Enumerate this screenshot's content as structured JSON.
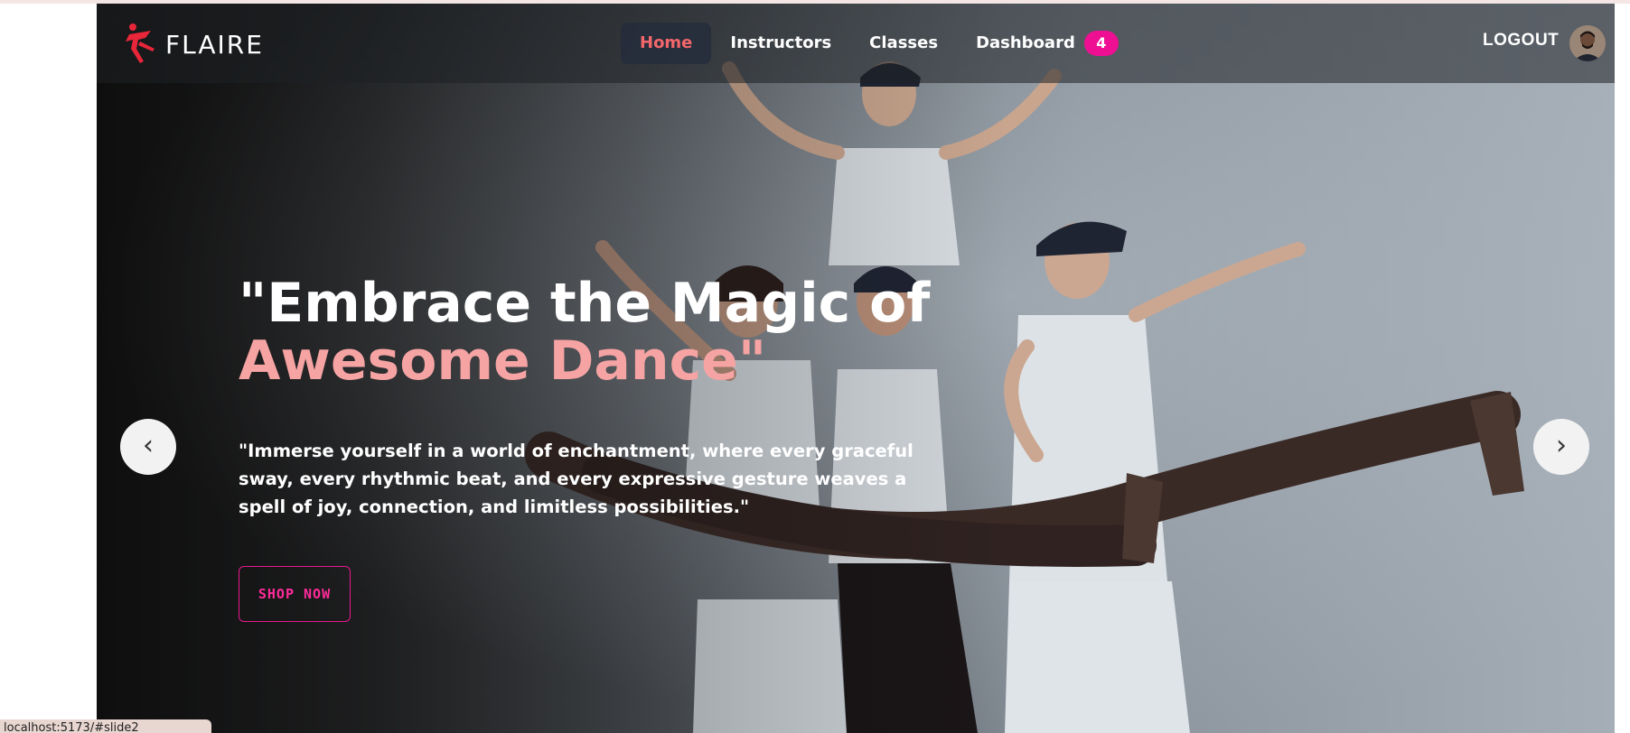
{
  "brand": {
    "name": "FLAIRE",
    "accent": "#e8263a"
  },
  "nav": {
    "items": [
      {
        "label": "Home",
        "active": true
      },
      {
        "label": "Instructors",
        "active": false
      },
      {
        "label": "Classes",
        "active": false
      },
      {
        "label": "Dashboard",
        "active": false,
        "badge": "4"
      }
    ],
    "logout_label": "LOGOUT",
    "active_color": "#f3676b",
    "badge_color": "#ef0f92"
  },
  "hero": {
    "headline_line1": "\"Embrace the Magic of",
    "headline_line2": "Awesome Dance\"",
    "subtext": "\"Immerse yourself in a world of enchantment, where every graceful sway, every rhythmic beat, and every expressive gesture weaves a spell of joy, connection, and limitless possibilities.\"",
    "cta_label": "SHOP NOW",
    "prev_label": "‹",
    "next_label": "›",
    "accent_color": "#f6a3a3",
    "cta_color": "#ff2b9a"
  },
  "status_bar": {
    "url": "localhost:5173/#slide2"
  }
}
